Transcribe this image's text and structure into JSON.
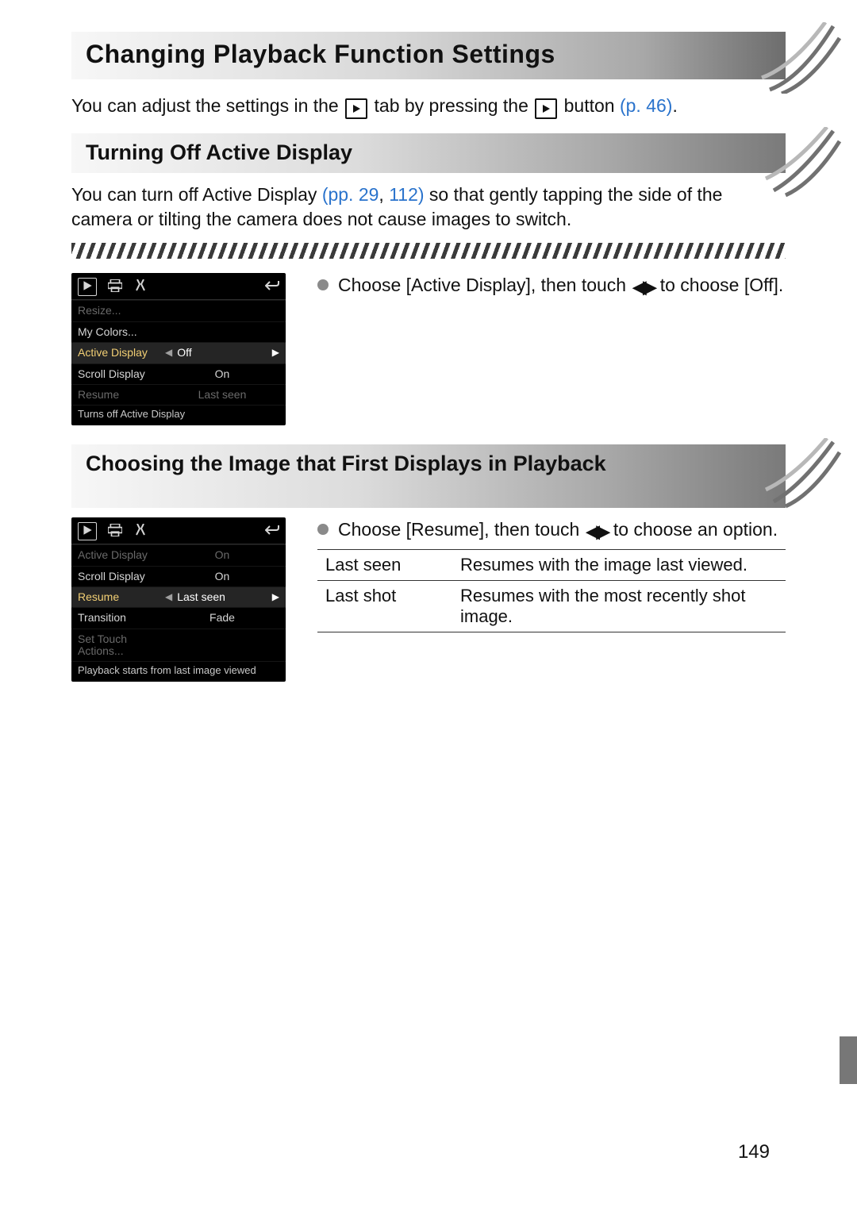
{
  "headings": {
    "h1": "Changing Playback Function Settings",
    "h2a": "Turning Off Active Display",
    "h2b": "Choosing the Image that First Displays in Playback"
  },
  "intro": {
    "pre": "You can adjust the settings in the ",
    "mid": " tab by pressing the ",
    "post": " button ",
    "ref": "(p. 46)",
    "period": "."
  },
  "section_a": {
    "body_pre": "You can turn off Active Display ",
    "body_ref1": "(pp. 29",
    "body_ref_sep": ", ",
    "body_ref2": "112)",
    "body_post": " so that gently tapping the side of the camera  or tilting the camera does not cause images to switch.",
    "instruction_pre": "Choose [Active Display], then touch ",
    "instruction_post": " to choose [Off]."
  },
  "lcd_a": {
    "items": [
      {
        "label": "Resize...",
        "value": "",
        "dim": true
      },
      {
        "label": "My Colors...",
        "value": ""
      },
      {
        "label": "Active Display",
        "value": "Off",
        "selected": true
      },
      {
        "label": "Scroll Display",
        "value": "On"
      },
      {
        "label": "Resume",
        "value": "Last seen",
        "dim": true
      }
    ],
    "hint": "Turns off Active Display"
  },
  "section_b": {
    "instruction_pre": "Choose [Resume], then touch ",
    "instruction_post": " to choose an option."
  },
  "lcd_b": {
    "items": [
      {
        "label": "Active Display",
        "value": "On",
        "dim": true
      },
      {
        "label": "Scroll Display",
        "value": "On"
      },
      {
        "label": "Resume",
        "value": "Last seen",
        "selected": true
      },
      {
        "label": "Transition",
        "value": "Fade"
      },
      {
        "label": "Set Touch Actions...",
        "value": "",
        "dim": true
      }
    ],
    "hint": "Playback starts from last image viewed"
  },
  "options_table": [
    {
      "k": "Last seen",
      "v": "Resumes with the image last viewed."
    },
    {
      "k": "Last shot",
      "v": "Resumes with the most recently shot image."
    }
  ],
  "page_number": "149"
}
